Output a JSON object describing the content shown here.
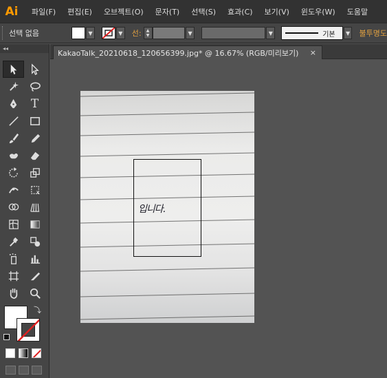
{
  "app": {
    "logo": "Ai"
  },
  "menu": [
    "파일(F)",
    "편집(E)",
    "오브젝트(O)",
    "문자(T)",
    "선택(S)",
    "효과(C)",
    "보기(V)",
    "윈도우(W)",
    "도움말"
  ],
  "controlbar": {
    "selection_status": "선택 없음",
    "stroke_label": "선:",
    "brush_label": "기본",
    "opacity_label": "불투명도"
  },
  "panel": {
    "collapse_glyph": "◂◂"
  },
  "tab": {
    "title": "KakaoTalk_20210618_120656399.jpg* @ 16.67% (RGB/미리보기)",
    "close": "×"
  },
  "artwork": {
    "handwriting": "입니다."
  },
  "colors": {
    "fill": "#ffffff",
    "stroke": "none",
    "accent": "#e0a040"
  },
  "tools": [
    [
      "selection-tool",
      "direct-selection-tool"
    ],
    [
      "magic-wand-tool",
      "lasso-tool"
    ],
    [
      "pen-tool",
      "type-tool"
    ],
    [
      "line-segment-tool",
      "rectangle-tool"
    ],
    [
      "paintbrush-tool",
      "pencil-tool"
    ],
    [
      "blob-brush-tool",
      "eraser-tool"
    ],
    [
      "rotate-tool",
      "scale-tool"
    ],
    [
      "width-tool",
      "free-transform-tool"
    ],
    [
      "shape-builder-tool",
      "perspective-grid-tool"
    ],
    [
      "mesh-tool",
      "gradient-tool"
    ],
    [
      "eyedropper-tool",
      "blend-tool"
    ],
    [
      "symbol-sprayer-tool",
      "column-graph-tool"
    ],
    [
      "artboard-tool",
      "slice-tool"
    ],
    [
      "hand-tool",
      "zoom-tool"
    ]
  ],
  "type_glyph": "T"
}
